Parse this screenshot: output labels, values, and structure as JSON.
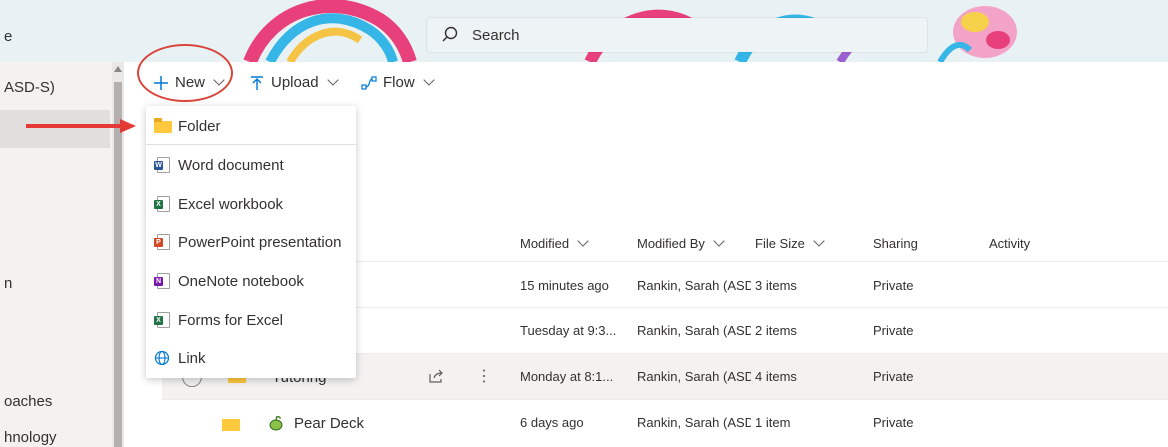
{
  "header": {
    "app_name": "e",
    "search_placeholder": "Search"
  },
  "sidebar": {
    "items": [
      {
        "label": "ASD-S)"
      },
      {
        "label": "n"
      },
      {
        "label": "oaches"
      },
      {
        "label": "hnology"
      }
    ]
  },
  "command_bar": {
    "new_label": "New",
    "upload_label": "Upload",
    "flow_label": "Flow"
  },
  "new_menu": {
    "items": [
      {
        "label": "Folder",
        "icon": "folder-icon"
      },
      {
        "label": "Word document",
        "icon": "word-icon"
      },
      {
        "label": "Excel workbook",
        "icon": "excel-icon"
      },
      {
        "label": "PowerPoint presentation",
        "icon": "powerpoint-icon"
      },
      {
        "label": "OneNote notebook",
        "icon": "onenote-icon"
      },
      {
        "label": "Forms for Excel",
        "icon": "excel-icon"
      },
      {
        "label": "Link",
        "icon": "globe-icon"
      }
    ]
  },
  "columns": {
    "modified": "Modified",
    "modified_by": "Modified By",
    "file_size": "File Size",
    "sharing": "Sharing",
    "activity": "Activity"
  },
  "rows": [
    {
      "name": "",
      "modified": "15 minutes ago",
      "modified_by": "Rankin, Sarah (ASD",
      "file_size": "3 items",
      "sharing": "Private"
    },
    {
      "name": "",
      "modified": "Tuesday at 9:3...",
      "modified_by": "Rankin, Sarah (ASD",
      "file_size": "2 items",
      "sharing": "Private"
    },
    {
      "name": "Tutoring",
      "modified": "Monday at 8:1...",
      "modified_by": "Rankin, Sarah (ASD",
      "file_size": "4 items",
      "sharing": "Private"
    },
    {
      "name": "Pear Deck",
      "modified": "6 days ago",
      "modified_by": "Rankin, Sarah (ASD",
      "file_size": "1 item",
      "sharing": "Private"
    }
  ],
  "colors": {
    "accent": "#0078d4",
    "annotation_red": "#d9453a",
    "folder_yellow": "#ffc83d",
    "word_blue": "#2b579a",
    "excel_green": "#217346",
    "powerpoint_red": "#d24726",
    "onenote_purple": "#7719aa"
  }
}
